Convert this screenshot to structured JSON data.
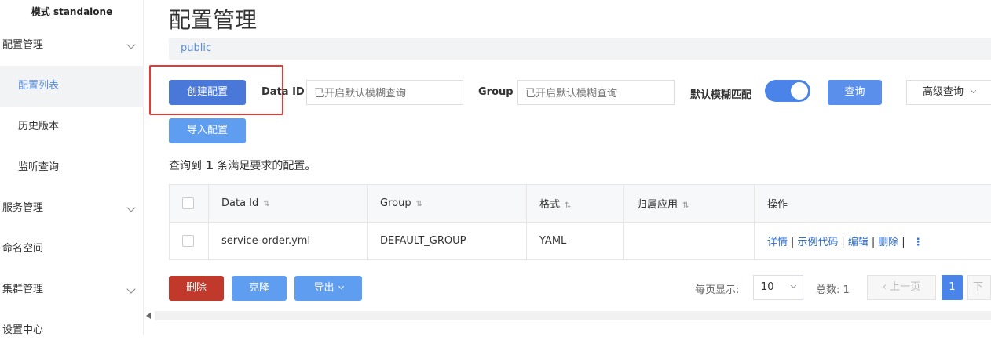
{
  "sidebar": {
    "mode": "模式 standalone",
    "items": [
      {
        "label": "配置管理",
        "type": "top",
        "expandable": true
      },
      {
        "label": "配置列表",
        "type": "sub",
        "active": true
      },
      {
        "label": "历史版本",
        "type": "sub"
      },
      {
        "label": "监听查询",
        "type": "sub"
      },
      {
        "label": "服务管理",
        "type": "top",
        "expandable": true
      },
      {
        "label": "命名空间",
        "type": "top"
      },
      {
        "label": "集群管理",
        "type": "top",
        "expandable": true
      },
      {
        "label": "设置中心",
        "type": "top"
      }
    ]
  },
  "header": {
    "title": "配置管理",
    "namespace": "public"
  },
  "toolbar": {
    "create_label": "创建配置",
    "import_label": "导入配置",
    "data_id_label": "Data ID",
    "data_id_placeholder": "已开启默认模糊查询",
    "group_label": "Group",
    "group_placeholder": "已开启默认模糊查询",
    "fuzzy_label": "默认模糊匹配",
    "fuzzy_on": true,
    "query_label": "查询",
    "advanced_label": "高级查询"
  },
  "summary": {
    "prefix": "查询到",
    "count": "1",
    "suffix": "条满足要求的配置。"
  },
  "table": {
    "headers": [
      "Data Id",
      "Group",
      "格式",
      "归属应用",
      "操作"
    ],
    "rows": [
      {
        "data_id": "service-order.yml",
        "group": "DEFAULT_GROUP",
        "format": "YAML",
        "app": ""
      }
    ],
    "ops": [
      "详情",
      "示例代码",
      "编辑",
      "删除"
    ]
  },
  "bulk": {
    "delete_label": "删除",
    "clone_label": "克隆",
    "export_label": "导出"
  },
  "pager": {
    "page_size_label": "每页显示:",
    "page_size": "10",
    "total_label": "总数: 1",
    "prev_label": "上一页",
    "current": "1",
    "next_label": "下一"
  },
  "colors": {
    "primary": "#4a78d8",
    "danger": "#c0392b",
    "link": "#2f6fd4",
    "highlight": "#e53935"
  }
}
